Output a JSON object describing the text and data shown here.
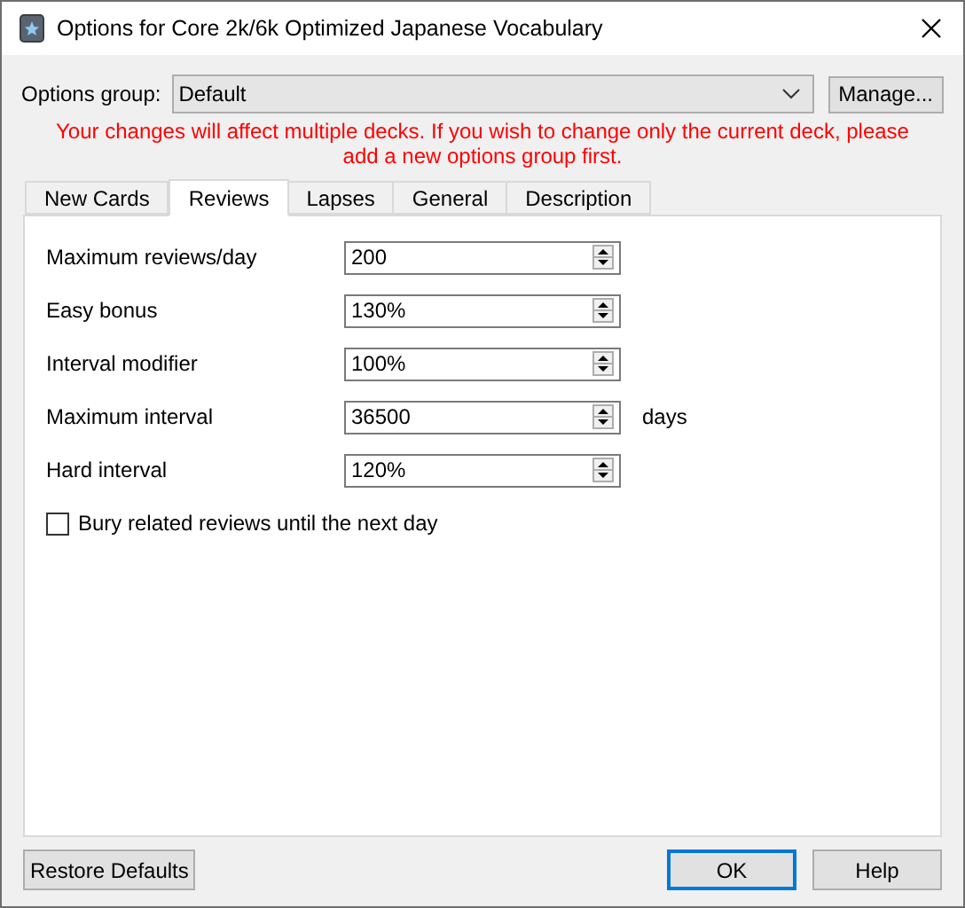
{
  "window": {
    "title": "Options for Core 2k/6k Optimized Japanese Vocabulary"
  },
  "options_group": {
    "label": "Options group:",
    "value": "Default",
    "manage_button": "Manage..."
  },
  "warning": "Your changes will affect multiple decks. If you wish to change only the current deck, please add a new options group first.",
  "tabs": [
    {
      "label": "New Cards",
      "selected": false
    },
    {
      "label": "Reviews",
      "selected": true
    },
    {
      "label": "Lapses",
      "selected": false
    },
    {
      "label": "General",
      "selected": false
    },
    {
      "label": "Description",
      "selected": false
    }
  ],
  "fields": [
    {
      "label": "Maximum reviews/day",
      "value": "200"
    },
    {
      "label": "Easy bonus",
      "value": "130%"
    },
    {
      "label": "Interval modifier",
      "value": "100%"
    },
    {
      "label": "Maximum interval",
      "value": "36500",
      "unit": "days"
    },
    {
      "label": "Hard interval",
      "value": "120%"
    }
  ],
  "checkbox": {
    "label": "Bury related reviews until the next day",
    "checked": false
  },
  "buttons": [
    {
      "label": "Restore Defaults",
      "kind": "left",
      "default": false
    },
    {
      "label": "OK",
      "kind": "right",
      "default": true
    },
    {
      "label": "Help",
      "kind": "right",
      "default": false
    }
  ]
}
